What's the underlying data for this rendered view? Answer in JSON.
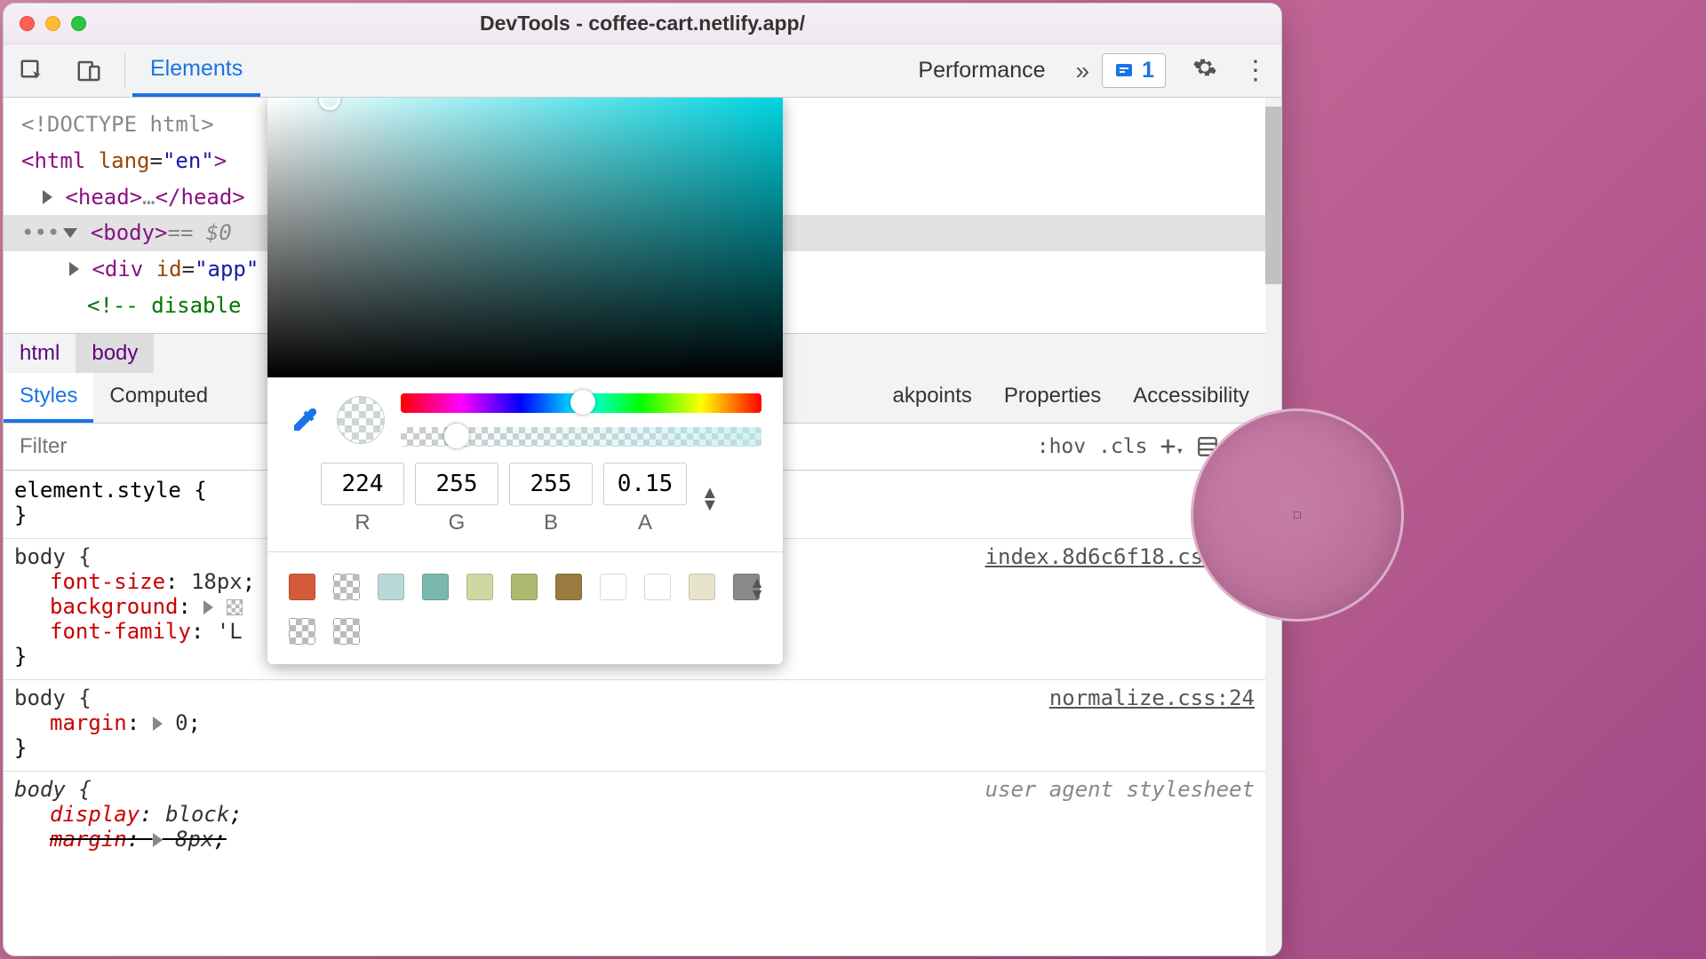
{
  "window": {
    "title": "DevTools - coffee-cart.netlify.app/"
  },
  "toolbar": {
    "tabs": [
      "Elements",
      "Performance"
    ],
    "issues_count": "1"
  },
  "dom": {
    "doctype": "<!DOCTYPE html>",
    "html_open": "<html lang=\"en\">",
    "head": "<head>…</head>",
    "body_sel": "<body>",
    "body_annot": " == $0",
    "app_div": "<div id=\"app\"",
    "comment_frag": "<!-- disable",
    "comment_close": ">"
  },
  "breadcrumb": {
    "items": [
      "html",
      "body"
    ]
  },
  "subtabs": [
    "Styles",
    "Computed",
    "akpoints",
    "Properties",
    "Accessibility"
  ],
  "styles_toolbar": {
    "filter_placeholder": "Filter",
    "hov": ":hov",
    "cls": ".cls"
  },
  "styles": {
    "element_style": "element.style {",
    "close_brace": "}",
    "rule1": {
      "selector": "body {",
      "src": "index.8d6c6f18.css:64",
      "p1_name": "font-size",
      "p1_val": "18px",
      "p2_name": "background",
      "p3_name": "font-family",
      "p3_val": "'L"
    },
    "rule2": {
      "selector": "body {",
      "src": "normalize.css:24",
      "p1_name": "margin",
      "p1_val": "0"
    },
    "rule3": {
      "selector": "body {",
      "src": "user agent stylesheet",
      "p1_name": "display",
      "p1_val": "block",
      "p2_name": "margin",
      "p2_val": "8px"
    }
  },
  "color_picker": {
    "r": "224",
    "g": "255",
    "b": "255",
    "a": "0.15",
    "labels": {
      "r": "R",
      "g": "G",
      "b": "B",
      "a": "A"
    },
    "swatches": [
      "#d35a3a",
      "checker",
      "#b9d9d9",
      "#7ab8ad",
      "#cdd9a0",
      "#aeb86f",
      "#9b7a3f",
      "#ffffff",
      "#ffffff",
      "#e8e3cb",
      "#8a8a8a",
      "checker",
      "checker"
    ]
  }
}
